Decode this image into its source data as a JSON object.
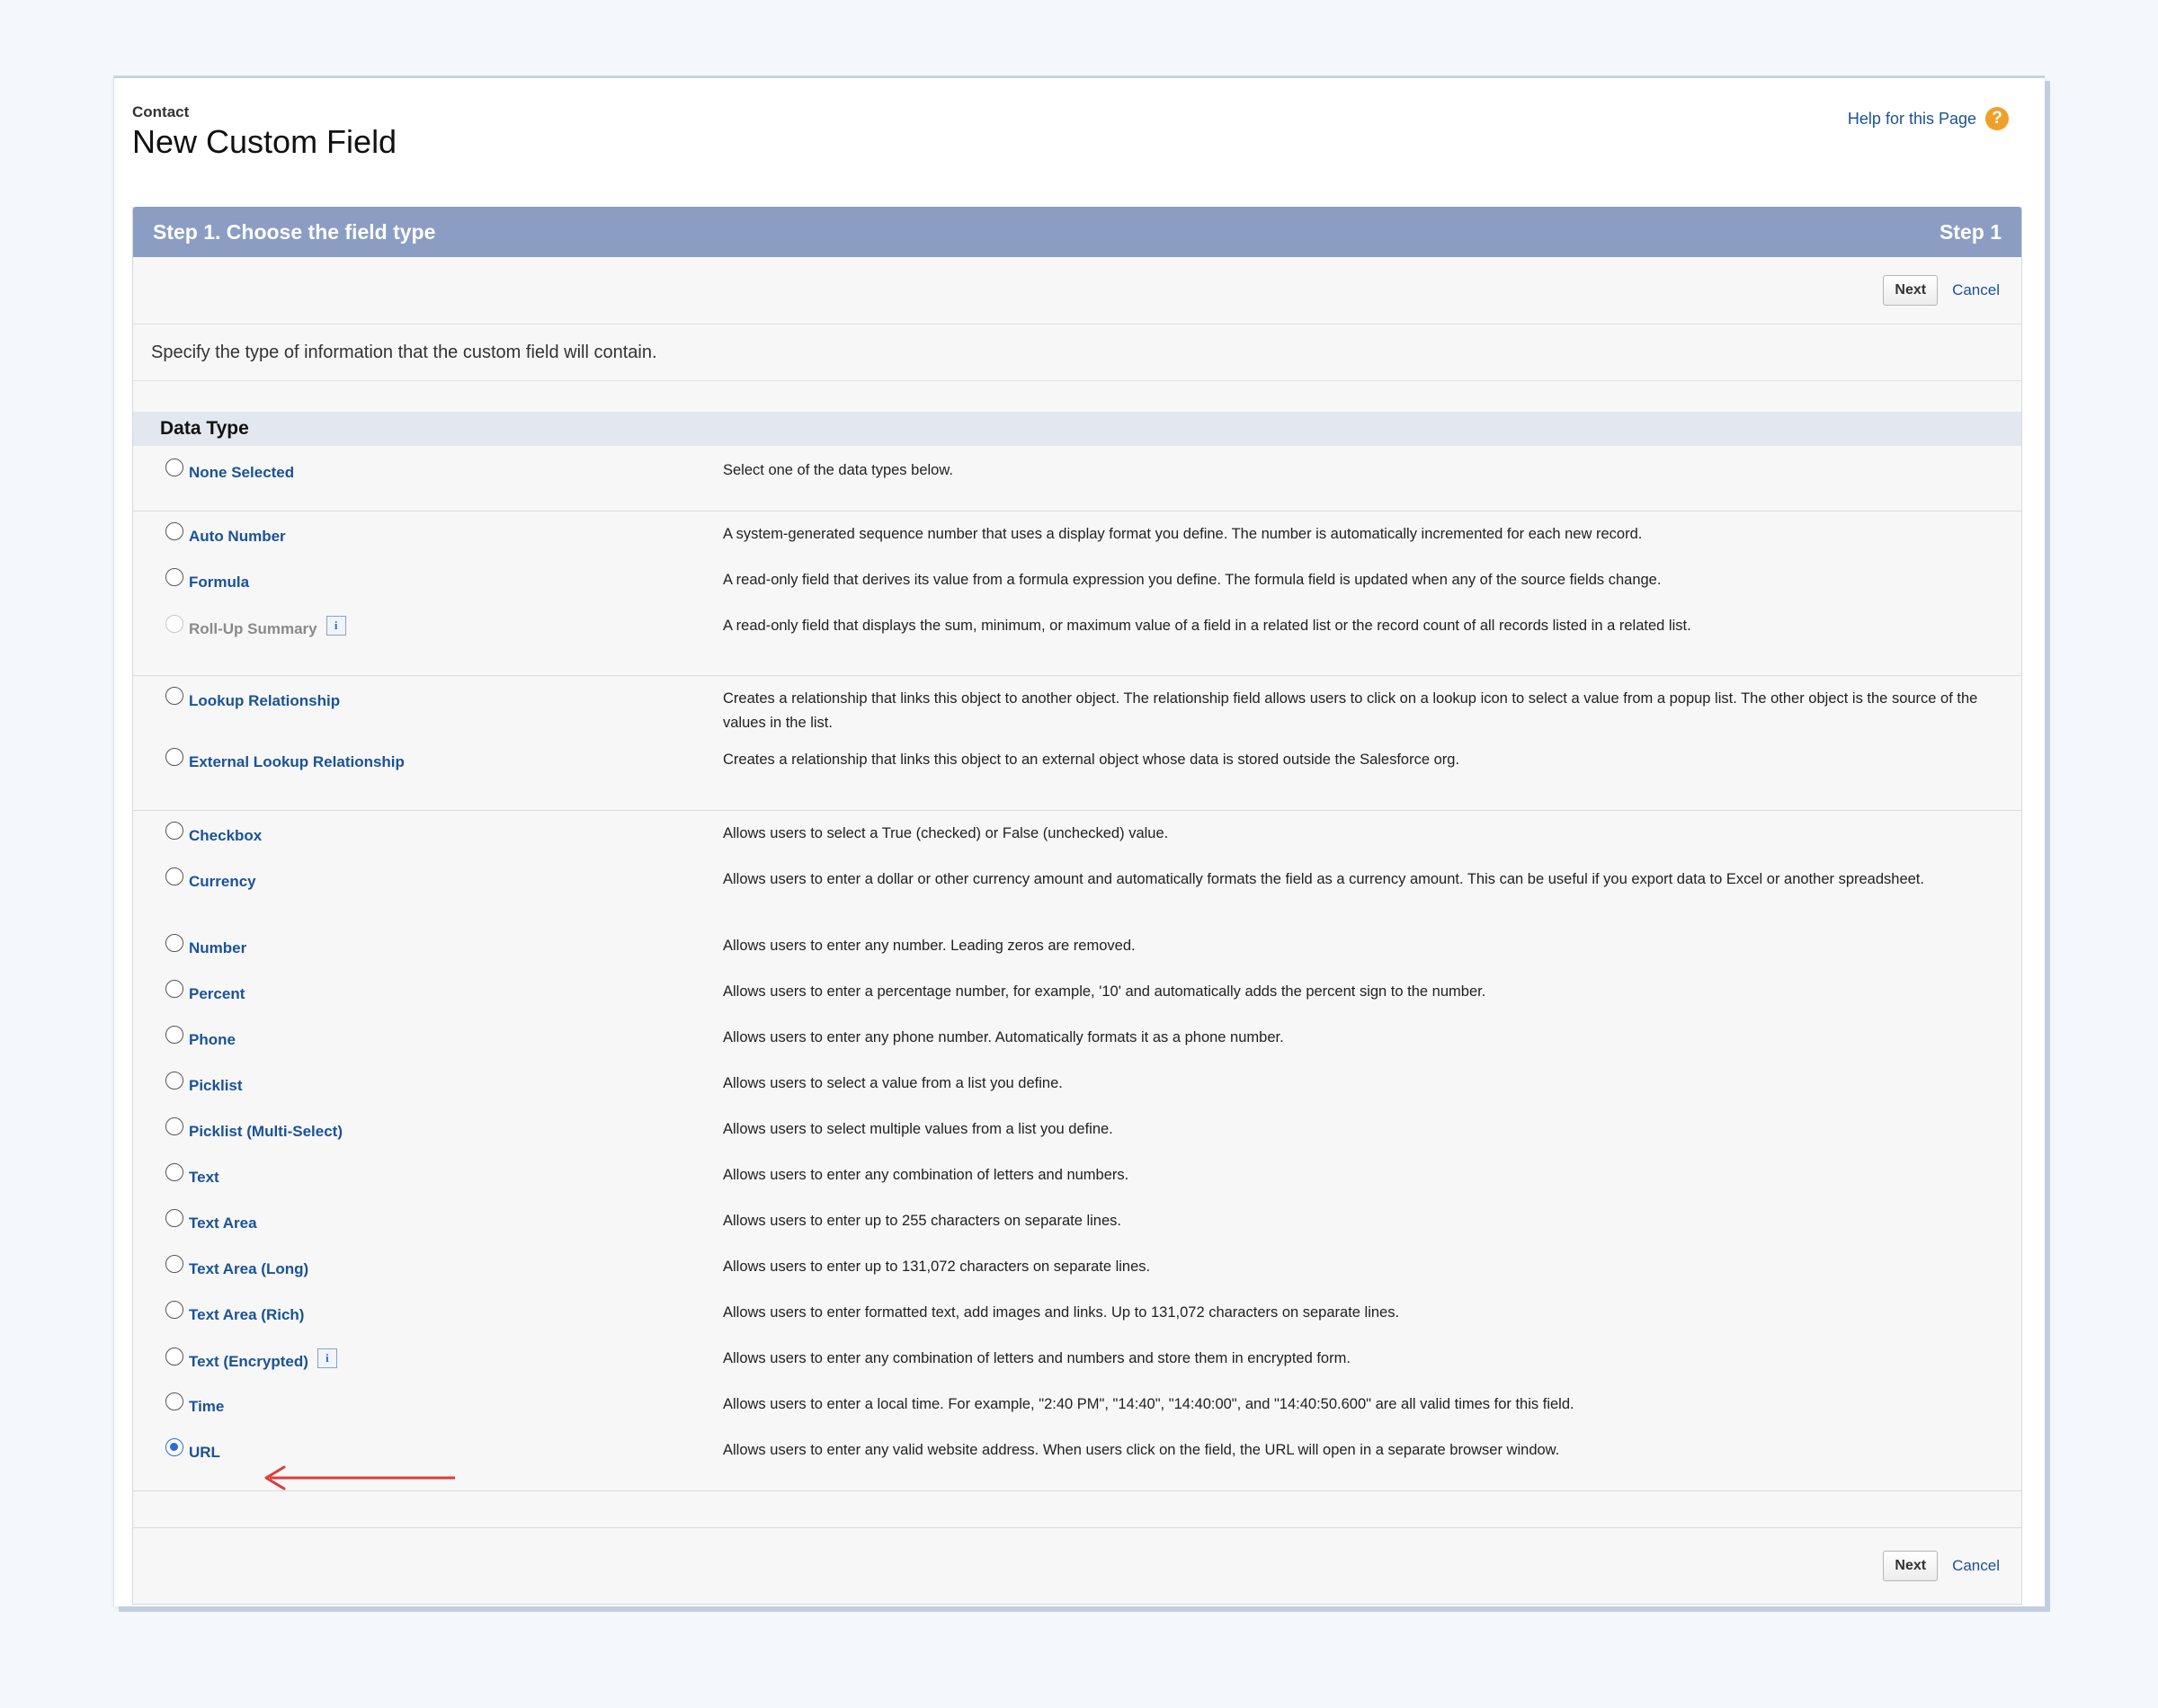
{
  "header": {
    "object_name": "Contact",
    "title": "New Custom Field",
    "help_link": "Help for this Page",
    "help_icon": "?"
  },
  "step": {
    "title": "Step 1. Choose the field type",
    "label": "Step 1"
  },
  "buttons": {
    "next": "Next",
    "cancel": "Cancel"
  },
  "instructions": "Specify the type of information that the custom field will contain.",
  "section_title": "Data Type",
  "info_icon_glyph": "i",
  "selected": "URL",
  "groups": [
    [
      {
        "label": "None Selected",
        "desc": "Select one of the data types below."
      }
    ],
    [
      {
        "label": "Auto Number",
        "desc": "A system-generated sequence number that uses a display format you define. The number is automatically incremented for each new record."
      },
      {
        "label": "Formula",
        "desc": "A read-only field that derives its value from a formula expression you define. The formula field is updated when any of the source fields change."
      },
      {
        "label": "Roll-Up Summary",
        "desc": "A read-only field that displays the sum, minimum, or maximum value of a field in a related list or the record count of all records listed in a related list.",
        "disabled": true,
        "info": true
      }
    ],
    [
      {
        "label": "Lookup Relationship",
        "desc": "Creates a relationship that links this object to another object. The relationship field allows users to click on a lookup icon to select a value from a popup list. The other object is the source of the values in the list."
      },
      {
        "label": "External Lookup Relationship",
        "desc": "Creates a relationship that links this object to an external object whose data is stored outside the Salesforce org."
      }
    ],
    [
      {
        "label": "Checkbox",
        "desc": "Allows users to select a True (checked) or False (unchecked) value."
      },
      {
        "label": "Currency",
        "desc": "Allows users to enter a dollar or other currency amount and automatically formats the field as a currency amount. This can be useful if you export data to Excel or another spreadsheet."
      },
      {
        "label": "Number",
        "desc": "Allows users to enter any number. Leading zeros are removed."
      },
      {
        "label": "Percent",
        "desc": "Allows users to enter a percentage number, for example, '10' and automatically adds the percent sign to the number."
      },
      {
        "label": "Phone",
        "desc": "Allows users to enter any phone number. Automatically formats it as a phone number."
      },
      {
        "label": "Picklist",
        "desc": "Allows users to select a value from a list you define."
      },
      {
        "label": "Picklist (Multi-Select)",
        "desc": "Allows users to select multiple values from a list you define."
      },
      {
        "label": "Text",
        "desc": "Allows users to enter any combination of letters and numbers."
      },
      {
        "label": "Text Area",
        "desc": "Allows users to enter up to 255 characters on separate lines."
      },
      {
        "label": "Text Area (Long)",
        "desc": "Allows users to enter up to 131,072 characters on separate lines."
      },
      {
        "label": "Text Area (Rich)",
        "desc": "Allows users to enter formatted text, add images and links. Up to 131,072 characters on separate lines."
      },
      {
        "label": "Text (Encrypted)",
        "desc": "Allows users to enter any combination of letters and numbers and store them in encrypted form.",
        "info": true
      },
      {
        "label": "Time",
        "desc": "Allows users to enter a local time. For example, \"2:40 PM\", \"14:40\", \"14:40:00\", and \"14:40:50.600\" are all valid times for this field."
      },
      {
        "label": "URL",
        "desc": "Allows users to enter any valid website address. When users click on the field, the URL will open in a separate browser window."
      }
    ]
  ],
  "colors": {
    "header_bar": "#8b9dc3",
    "link": "#1b5297",
    "help_icon": "#f0a02a",
    "annotation_arrow": "#e03b3b"
  }
}
